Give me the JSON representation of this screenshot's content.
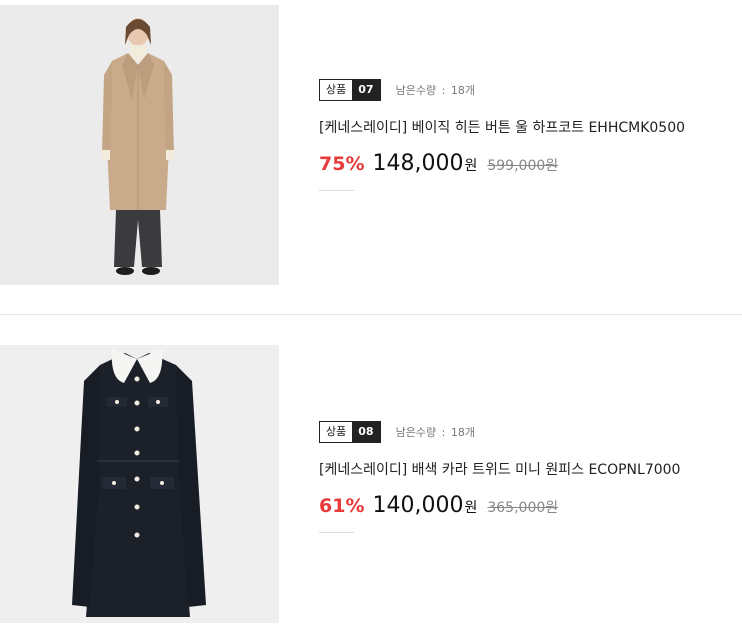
{
  "products": [
    {
      "tag_label": "상품",
      "tag_number": "07",
      "stock_label": "남은수량",
      "stock_value": "18개",
      "title": "[케네스레이디] 베이직 히든 버튼 울 하프코트 EHHCMK0500",
      "discount": "75%",
      "price": "148,000",
      "currency": "원",
      "original_price": "599,000원"
    },
    {
      "tag_label": "상품",
      "tag_number": "08",
      "stock_label": "남은수량",
      "stock_value": "18개",
      "title": "[케네스레이디] 배색 카라 트위드 미니 원피스 ECOPNL7000",
      "discount": "61%",
      "price": "140,000",
      "currency": "원",
      "original_price": "365,000원"
    }
  ],
  "colors": {
    "discount": "#e83a3a",
    "tag_dark": "#222222"
  }
}
